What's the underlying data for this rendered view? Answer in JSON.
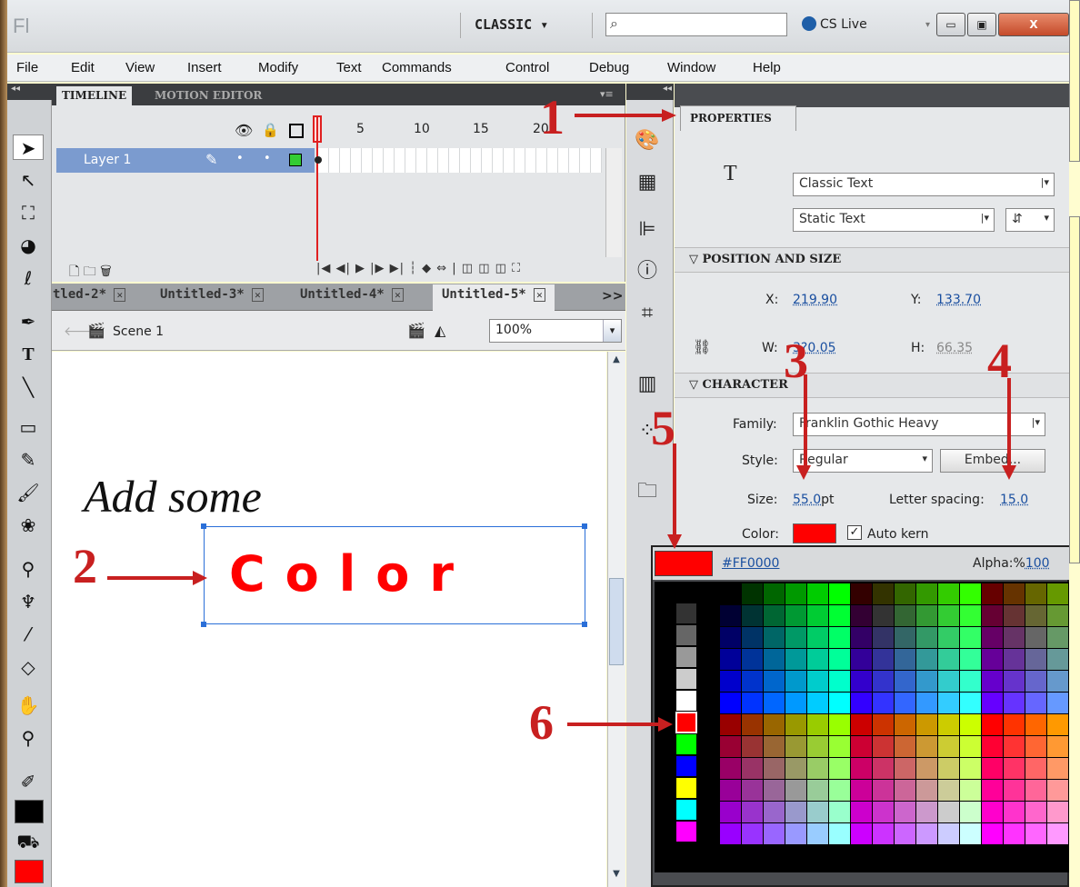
{
  "titlebar": {
    "logo": "Fl",
    "workspace": "CLASSIC ▾",
    "search_placeholder": "",
    "cs_live": "CS Live",
    "cs_live_chevron": "▾",
    "minimize": "▭",
    "maximize": "▣",
    "close": "X"
  },
  "menubar": {
    "items": [
      "File",
      "Edit",
      "View",
      "Insert",
      "Modify",
      "Text",
      "Commands",
      "Control",
      "Debug",
      "Window",
      "Help"
    ]
  },
  "timeline": {
    "tab_active": "TIMELINE",
    "tab_inactive": "MOTION EDITOR",
    "frame_numbers": [
      "5",
      "10",
      "15",
      "20"
    ],
    "layer_name": "Layer 1"
  },
  "doc_tabs": [
    "tled-2*",
    "Untitled-3*",
    "Untitled-4*",
    "Untitled-5*"
  ],
  "doc_tabs_more": ">>",
  "scene": {
    "label": "Scene 1",
    "zoom": "100%"
  },
  "stage": {
    "text_italic": "Add some",
    "text_bold": "Color"
  },
  "properties": {
    "tab": "PROPERTIES",
    "text_icon": "T",
    "text_engine": "Classic Text",
    "text_type": "Static Text",
    "position_section": "POSITION AND SIZE",
    "x_label": "X:",
    "x_value": "219.90",
    "y_label": "Y:",
    "y_value": "133.70",
    "w_label": "W:",
    "w_value": "3?0.05",
    "h_label": "H:",
    "h_value": "66.35",
    "character_section": "CHARACTER",
    "family_label": "Family:",
    "family_value": "Franklin Gothic Heavy",
    "style_label": "Style:",
    "style_value": "Regular",
    "embed_label": "Embed...",
    "size_label": "Size:",
    "size_value": "55.0",
    "size_unit": "pt",
    "letter_spacing_label": "Letter spacing:",
    "letter_spacing_value": "15.0",
    "color_label": "Color:",
    "auto_kern_label": "Auto kern",
    "auto_kern_checked": true,
    "color_hex": "#FF0000",
    "alpha_label": "Alpha:%",
    "alpha_value": "100"
  },
  "annotations": [
    "1",
    "2",
    "3",
    "4",
    "5",
    "6"
  ],
  "colors": {
    "accent": "#FF0000",
    "annotation": "#C82020",
    "layer_highlight": "#7B9BCF",
    "callout_bg": "#FFFCC0"
  },
  "icons": {
    "tools": [
      "selection-icon",
      "subselection-icon",
      "free-transform-icon",
      "3d-rotation-icon",
      "lasso-icon",
      "pen-icon",
      "text-icon",
      "line-icon",
      "rectangle-icon",
      "pencil-icon",
      "brush-icon",
      "deco-icon",
      "bone-icon",
      "paint-bucket-icon",
      "eyedropper-icon",
      "eraser-icon",
      "hand-icon",
      "zoom-icon",
      "stroke-color-icon",
      "fill-color-icon"
    ],
    "panel_strip": [
      "color-panel-icon",
      "swatches-icon",
      "align-icon",
      "info-icon",
      "transform-icon",
      "library-icon",
      "motion-presets-icon",
      "components-icon"
    ]
  }
}
